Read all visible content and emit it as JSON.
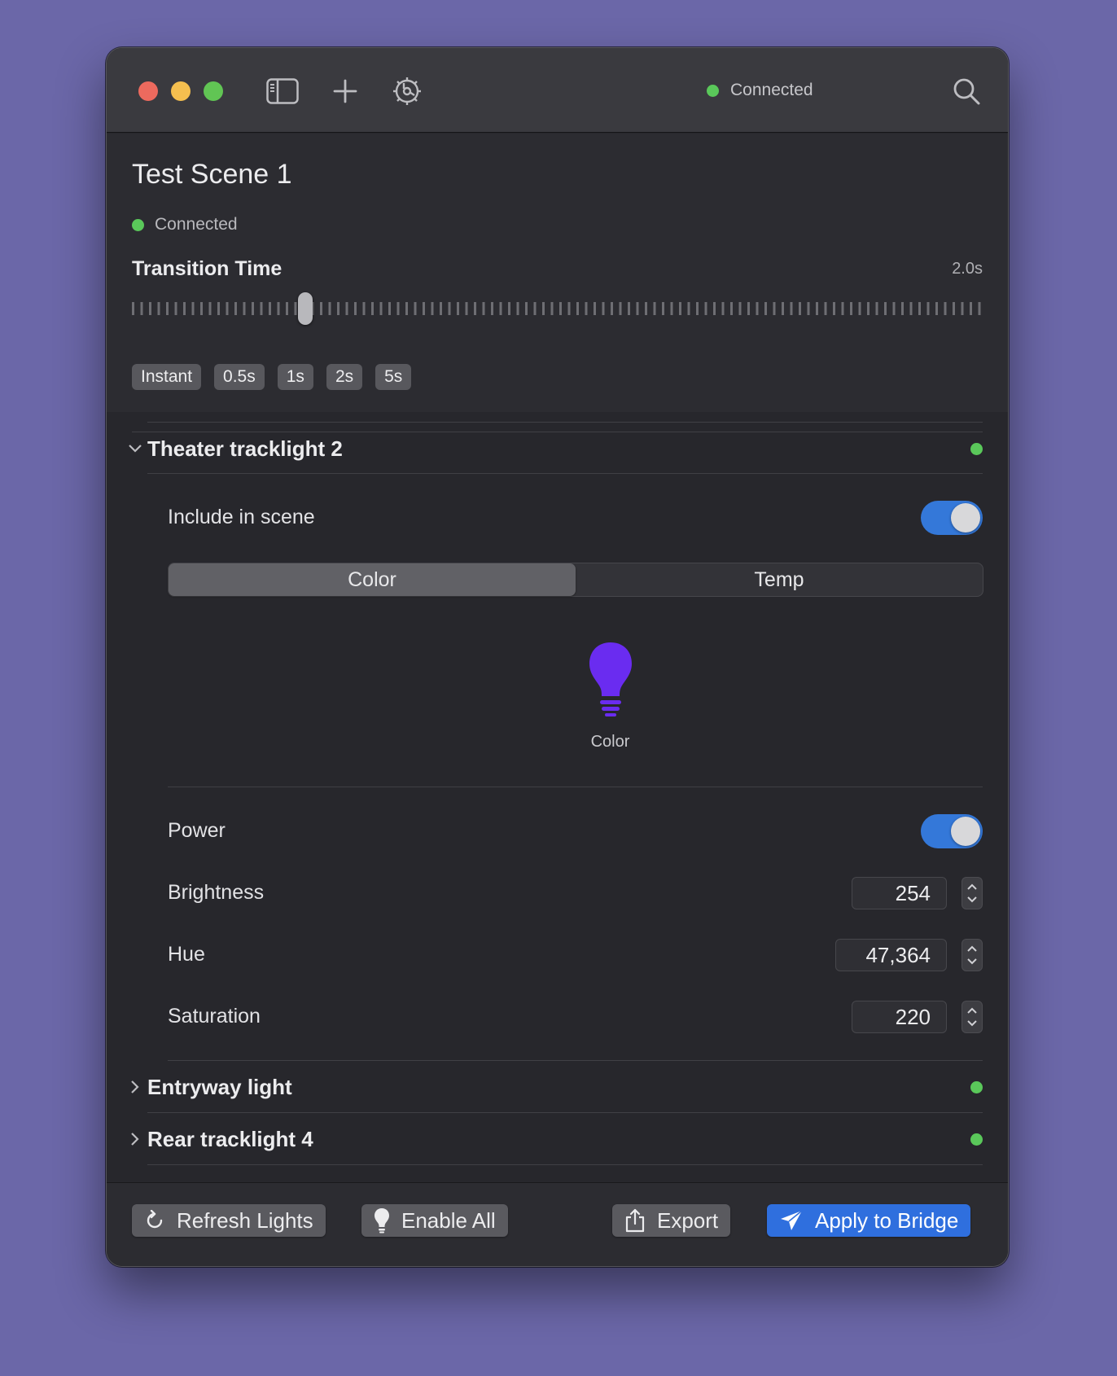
{
  "toolbar": {
    "status_text": "Connected",
    "icons": [
      "sidebar-toggle-icon",
      "plus-icon",
      "gear-icon",
      "search-icon"
    ]
  },
  "scene": {
    "title": "Test Scene 1",
    "status_text": "Connected"
  },
  "transition": {
    "label": "Transition Time",
    "value_text": "2.0s",
    "slider_value_seconds": 2.0,
    "presets": [
      "Instant",
      "0.5s",
      "1s",
      "2s",
      "5s"
    ]
  },
  "lights": [
    {
      "name": "Theater tracklight 2",
      "expanded": true,
      "include_label": "Include in scene",
      "include_on": true,
      "modes": [
        "Color",
        "Temp"
      ],
      "selected_mode": "Color",
      "preview_caption": "Color",
      "power_label": "Power",
      "power_on": true,
      "brightness_label": "Brightness",
      "brightness_value": "254",
      "hue_label": "Hue",
      "hue_value": "47,364",
      "saturation_label": "Saturation",
      "saturation_value": "220"
    },
    {
      "name": "Entryway light",
      "expanded": false
    },
    {
      "name": "Rear tracklight 4",
      "expanded": false
    }
  ],
  "footer": {
    "refresh_label": "Refresh Lights",
    "enable_all_label": "Enable All",
    "export_label": "Export",
    "apply_label": "Apply to Bridge"
  },
  "colors": {
    "background": "#6b67a8",
    "accent": "#3478d9",
    "primary_button": "#2f6fde",
    "status_green": "#5ac85a",
    "bulb": "#6a2cf0"
  }
}
